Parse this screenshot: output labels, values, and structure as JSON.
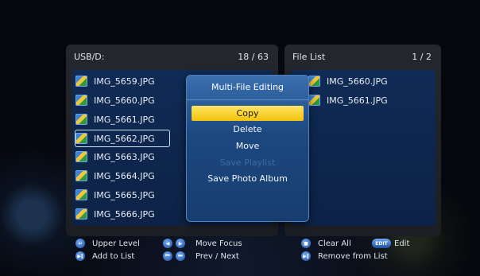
{
  "left_panel": {
    "path": "USB/D:",
    "count": "18 / 63",
    "files": [
      "IMG_5659.JPG",
      "IMG_5660.JPG",
      "IMG_5661.JPG",
      "IMG_5662.JPG",
      "IMG_5663.JPG",
      "IMG_5664.JPG",
      "IMG_5665.JPG",
      "IMG_5666.JPG"
    ]
  },
  "right_panel": {
    "title": "File List",
    "count": "1 / 2",
    "files": [
      "IMG_5660.JPG",
      "IMG_5661.JPG"
    ]
  },
  "dialog": {
    "title": "Multi-File Editing",
    "items": [
      "Copy",
      "Delete",
      "Move",
      "Save Playlist",
      "Save Photo Album"
    ]
  },
  "legend": {
    "upper_level": "Upper Level",
    "add_to_list": "Add to List",
    "move_focus": "Move Focus",
    "prev_next": "Prev / Next",
    "clear_all": "Clear All",
    "edit": "Edit",
    "remove_from_list": "Remove from List",
    "edit_key": "EDIT"
  }
}
